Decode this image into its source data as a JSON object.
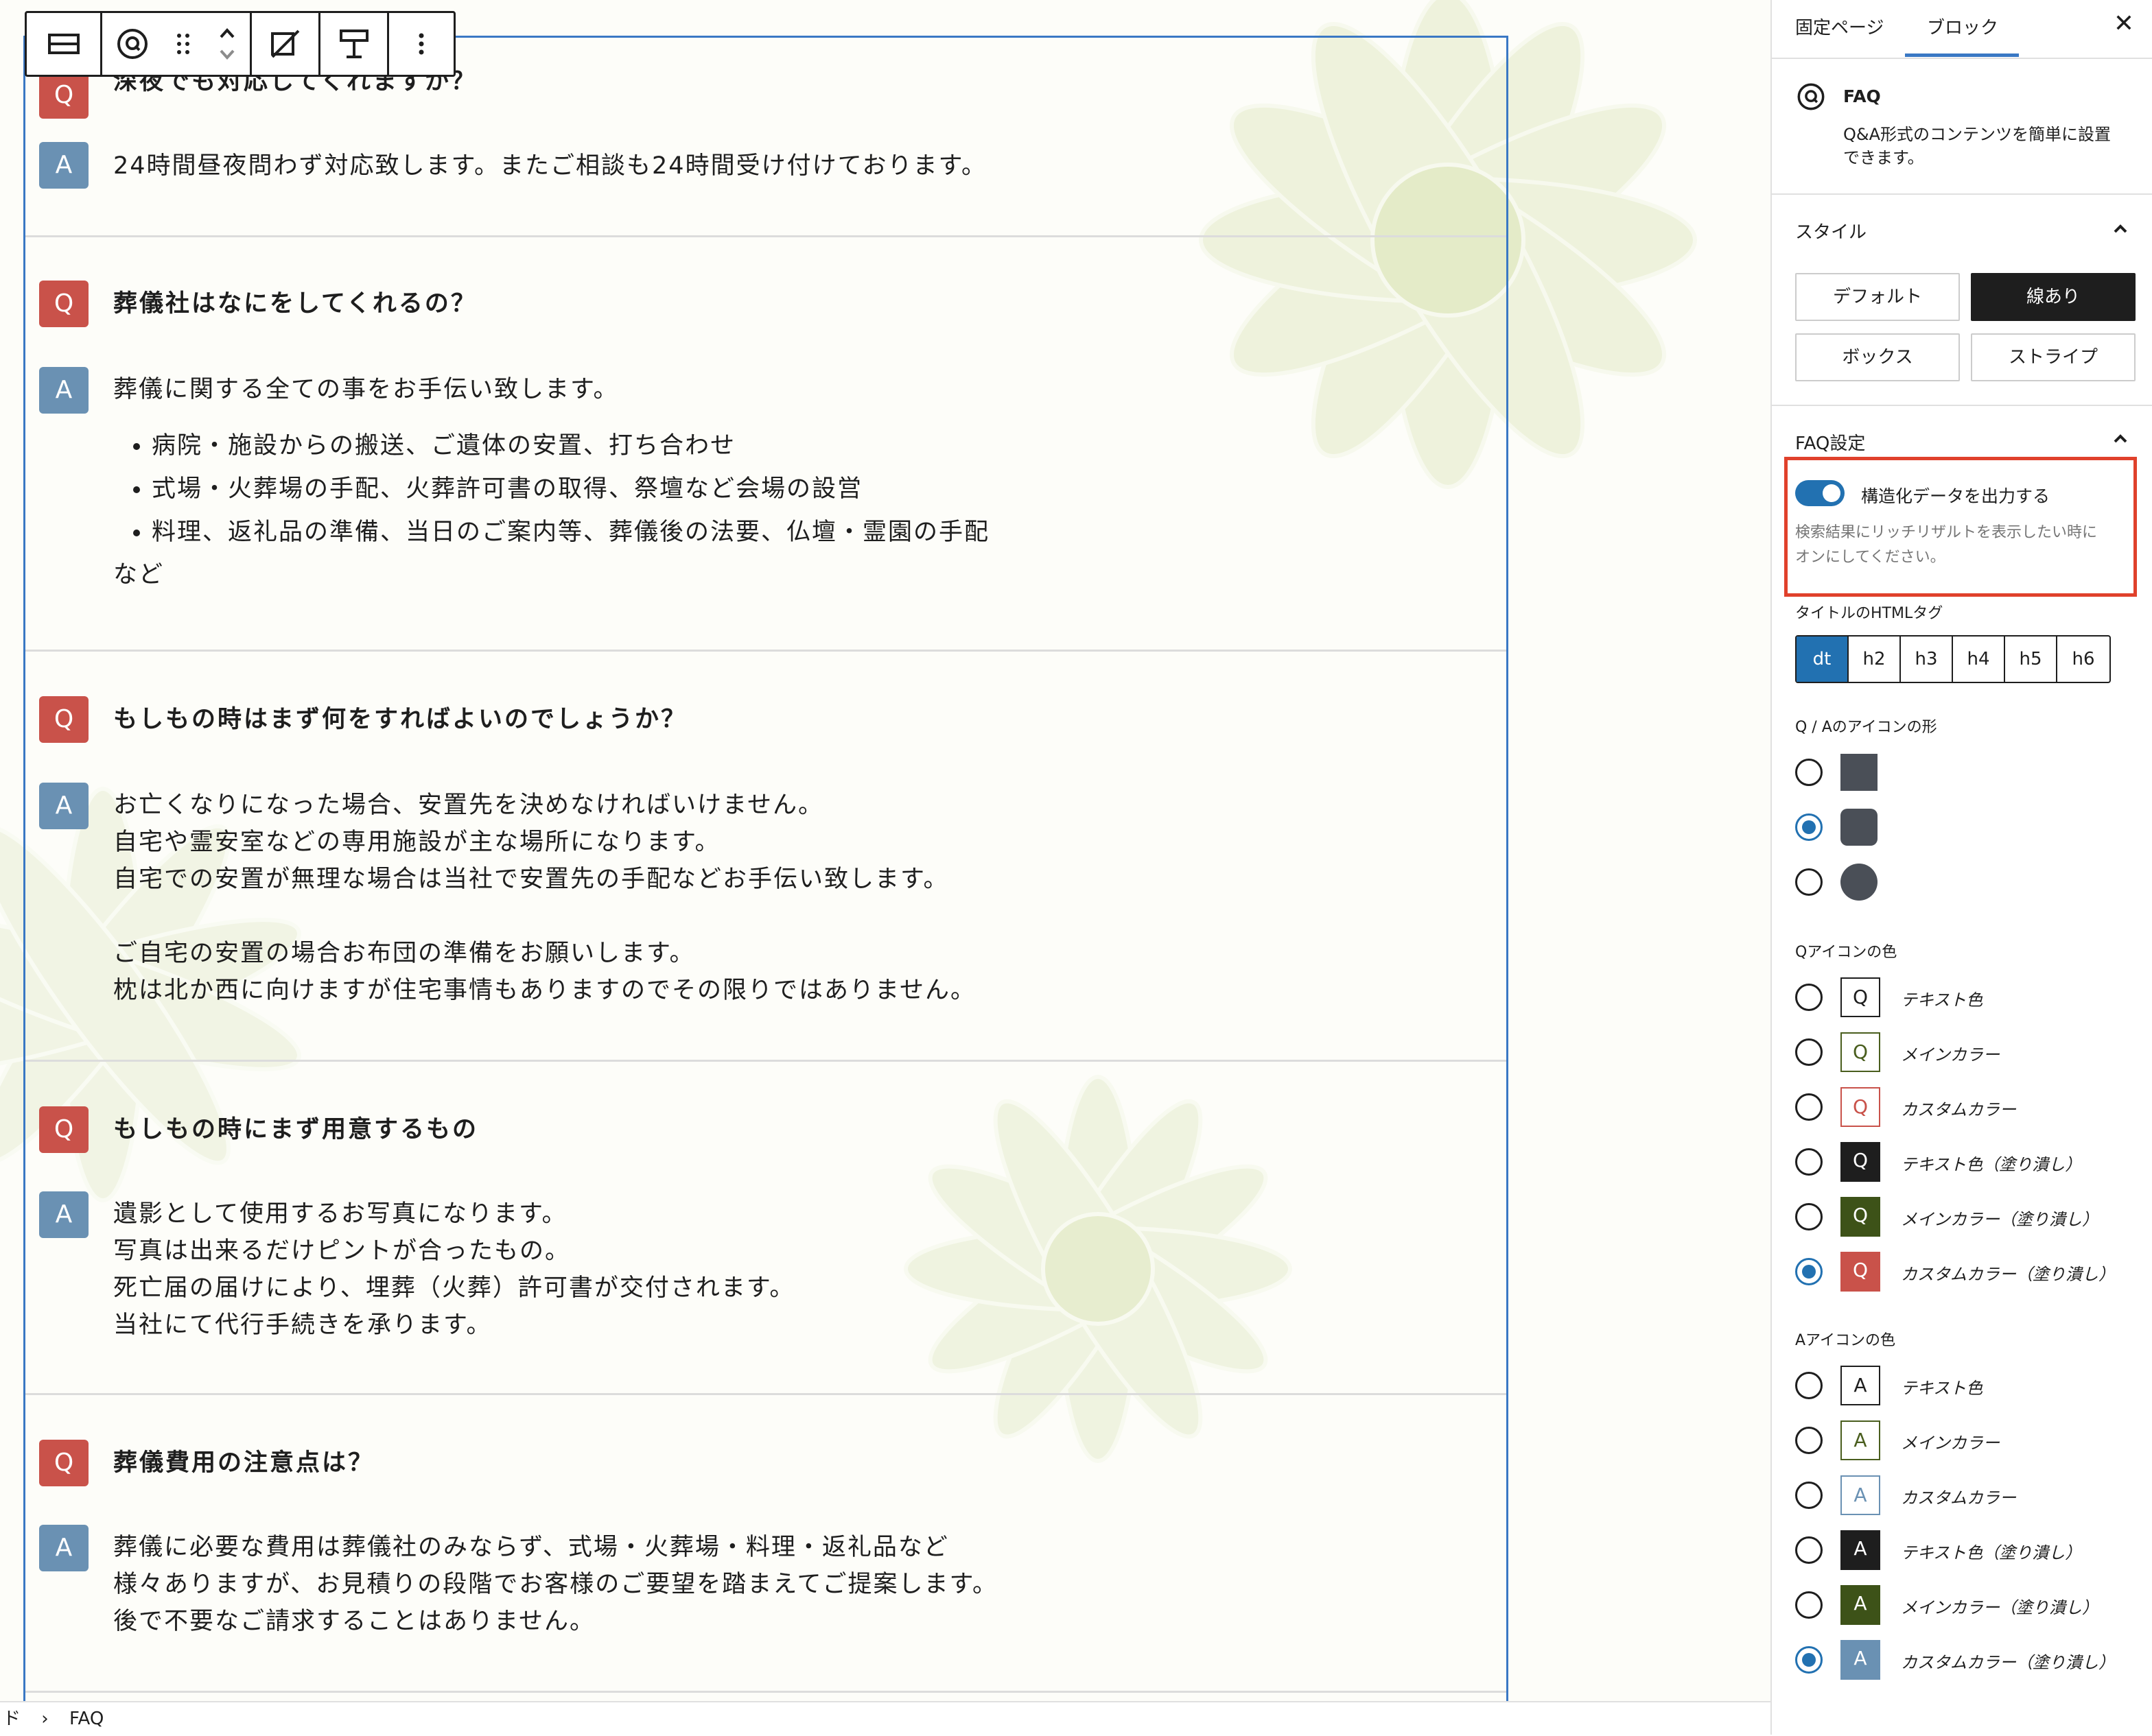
{
  "toolbar": {
    "buttons": [
      "block-type",
      "faq-block",
      "drag-handle",
      "move-up",
      "move-down",
      "align",
      "spacing",
      "more-options"
    ]
  },
  "faq": [
    {
      "q": "深夜でも対応してくれますか？",
      "a": [
        "24時間昼夜問わず対応致します。またご相談も24時間受け付けております。"
      ]
    },
    {
      "q": "葬儀社はなにをしてくれるの？",
      "a": [
        "葬儀に関する全ての事をお手伝い致します。"
      ],
      "list": [
        "病院・施設からの搬送、ご遺体の安置、打ち合わせ",
        "式場・火葬場の手配、火葬許可書の取得、祭壇など会場の設営",
        "料理、返礼品の準備、当日のご案内等、葬儀後の法要、仏壇・霊園の手配"
      ],
      "tail": "など"
    },
    {
      "q": "もしもの時はまず何をすればよいのでしょうか？",
      "a": [
        "お亡くなりになった場合、安置先を決めなければいけません。",
        "自宅や霊安室などの専用施設が主な場所になります。",
        "自宅での安置が無理な場合は当社で安置先の手配などお手伝い致します。",
        "",
        "ご自宅の安置の場合お布団の準備をお願いします。",
        "枕は北か西に向けますが住宅事情もありますのでその限りではありません。"
      ]
    },
    {
      "q": "もしもの時にまず用意するもの",
      "a": [
        "遺影として使用するお写真になります。",
        "写真は出来るだけピントが合ったもの。",
        "死亡届の届けにより、埋葬（火葬）許可書が交付されます。",
        "当社にて代行手続きを承ります。"
      ]
    },
    {
      "q": "葬儀費用の注意点は？",
      "a": [
        "葬儀に必要な費用は葬儀社のみならず、式場・火葬場・料理・返礼品など",
        "様々ありますが、お見積りの段階でお客様のご要望を踏まえてご提案します。",
        "後で不要なご請求することはありません。"
      ]
    }
  ],
  "icons": {
    "q_letter": "Q",
    "a_letter": "A",
    "q_color": "#c9524a",
    "a_color": "#6a91b3"
  },
  "breadcrumb": {
    "prefix": "ド",
    "separator": "›",
    "current": "FAQ"
  },
  "sidebar": {
    "tabs": [
      "固定ページ",
      "ブロック"
    ],
    "active_tab": "ブロック",
    "close": "✕",
    "block_card": {
      "title": "FAQ",
      "description_line1": "Q&A形式のコンテンツを簡単に設置",
      "description_line2": "できます。"
    },
    "style": {
      "title": "スタイル",
      "options": [
        "デフォルト",
        "線あり",
        "ボックス",
        "ストライプ"
      ],
      "selected": "線あり"
    },
    "faq_settings": {
      "title": "FAQ設定",
      "toggle_label": "構造化データを出力する",
      "toggle_on": true,
      "help_line1": "検索結果にリッチリザルトを表示したい時に",
      "help_line2": "オンにしてください。",
      "tag_label": "タイトルのHTMLタグ",
      "tags": [
        "dt",
        "h2",
        "h3",
        "h4",
        "h5",
        "h6"
      ],
      "selected_tag": "dt",
      "shape_label": "Q / Aのアイコンの形",
      "shapes": [
        "square",
        "rounded",
        "circle"
      ],
      "selected_shape": "rounded",
      "q_color_label": "Qアイコンの色",
      "a_color_label": "Aアイコンの色",
      "color_options": [
        "テキスト色",
        "メインカラー",
        "カスタムカラー",
        "テキスト色（塗り潰し）",
        "メインカラー（塗り潰し）",
        "カスタムカラー（塗り潰し）"
      ],
      "selected_color_index": 5
    }
  }
}
